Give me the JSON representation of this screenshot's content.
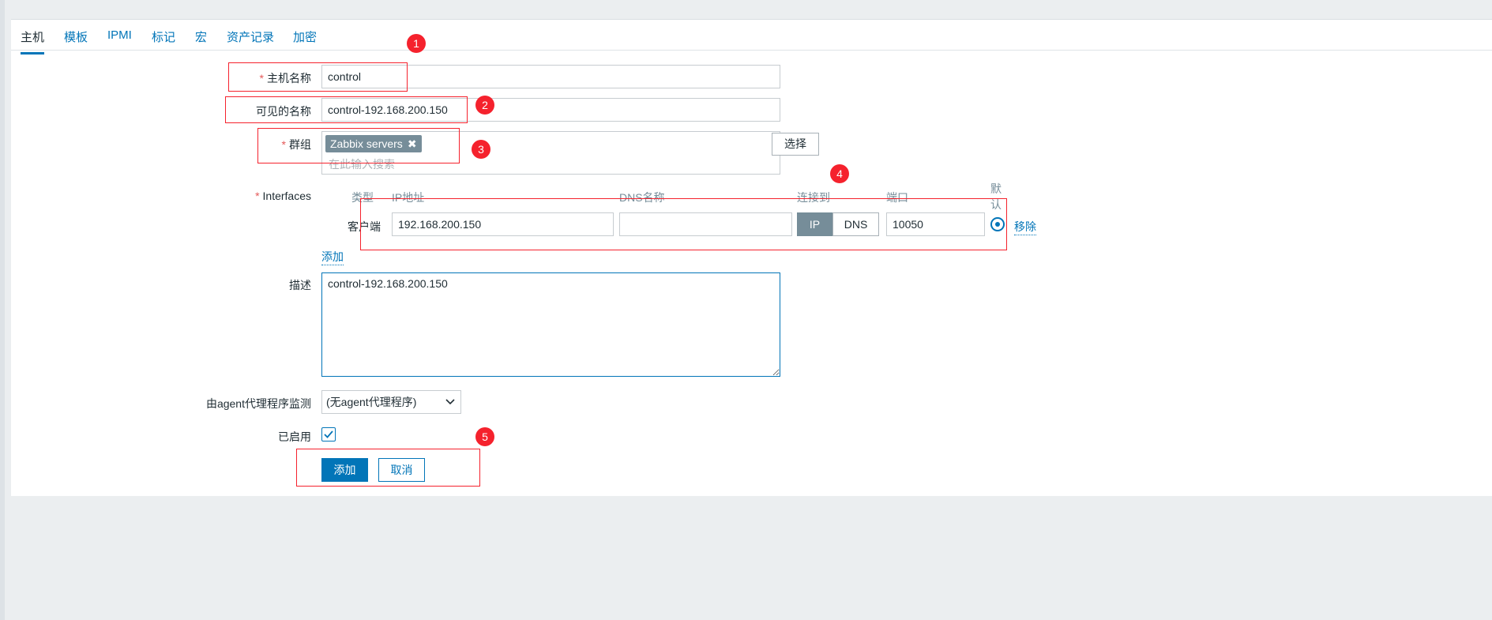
{
  "tabs": [
    {
      "label": "主机",
      "active": true
    },
    {
      "label": "模板"
    },
    {
      "label": "IPMI"
    },
    {
      "label": "标记"
    },
    {
      "label": "宏"
    },
    {
      "label": "资产记录"
    },
    {
      "label": "加密"
    }
  ],
  "form": {
    "host_name": {
      "label": "主机名称",
      "required_mark": "*",
      "value": "control"
    },
    "visible_name": {
      "label": "可见的名称",
      "value": "control-192.168.200.150"
    },
    "groups": {
      "label": "群组",
      "required_mark": "*",
      "chip": "Zabbix servers",
      "chip_remove_glyph": "✖",
      "placeholder": "在此输入搜索",
      "select_button": "选择"
    },
    "interfaces": {
      "label": "Interfaces",
      "required_mark": "*",
      "headers": {
        "type": "类型",
        "ip": "IP地址",
        "dns": "DNS名称",
        "connect": "连接到",
        "port": "端口",
        "default": "默认"
      },
      "row": {
        "type": "客户端",
        "ip": "192.168.200.150",
        "dns": "",
        "connect_ip": "IP",
        "connect_dns": "DNS",
        "connect_selected": "IP",
        "port": "10050",
        "default_selected": true,
        "remove": "移除"
      },
      "add_link": "添加"
    },
    "description": {
      "label": "描述",
      "value": "control-192.168.200.150"
    },
    "proxy": {
      "label": "由agent代理程序监测",
      "value": "(无agent代理程序)"
    },
    "enabled": {
      "label": "已启用",
      "checked": true
    },
    "buttons": {
      "add": "添加",
      "cancel": "取消"
    }
  },
  "annotations": [
    "1",
    "2",
    "3",
    "4",
    "5"
  ],
  "colors": {
    "accent": "#0275b8",
    "annotation": "#f5222d",
    "chip": "#768d99"
  }
}
